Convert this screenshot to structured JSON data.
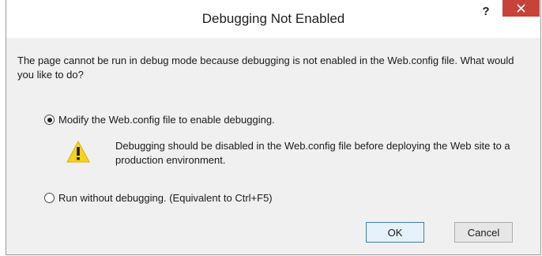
{
  "window": {
    "title": "Debugging Not Enabled",
    "help_label": "?",
    "close_icon": "close-icon"
  },
  "message": "The page cannot be run in debug mode because debugging is not enabled in the Web.config file. What would you like to do?",
  "options": [
    {
      "label": "Modify the Web.config file to enable debugging.",
      "checked": true
    },
    {
      "label": "Run without debugging. (Equivalent to Ctrl+F5)",
      "checked": false
    }
  ],
  "warning": {
    "icon": "warning-icon",
    "text": "Debugging should be disabled in the Web.config file before deploying the Web site to a production environment."
  },
  "buttons": {
    "ok_label": "OK",
    "cancel_label": "Cancel"
  },
  "colors": {
    "close_button": "#c7433a",
    "warning_yellow": "#f7d21e",
    "dialog_body": "#f0f0f0"
  }
}
